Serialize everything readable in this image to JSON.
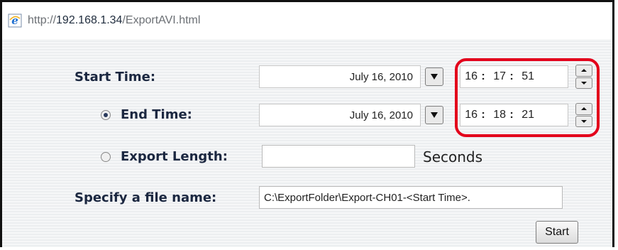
{
  "browser": {
    "url": "http://192.168.1.34/ExportAVI.html",
    "url_prefix": "http://",
    "url_host": "192.168.1.34",
    "url_path": "/ExportAVI.html"
  },
  "form": {
    "start_time": {
      "label": "Start Time:",
      "date": "July 16, 2010",
      "hour": "16",
      "minute": "17",
      "second": "51",
      "sep": ":"
    },
    "end_time": {
      "label": "End Time:",
      "date": "July 16, 2010",
      "hour": "16",
      "minute": "18",
      "second": "21",
      "sep": ":",
      "selected": true
    },
    "export_length": {
      "label": "Export Length:",
      "value": "",
      "unit": "Seconds",
      "selected": false
    },
    "file_name": {
      "label": "Specify a file name:",
      "value": "C:\\ExportFolder\\Export-CH01-<Start Time>."
    },
    "start_button": "Start"
  },
  "colors": {
    "highlight": "#e3001b",
    "label": "#1b2740"
  }
}
